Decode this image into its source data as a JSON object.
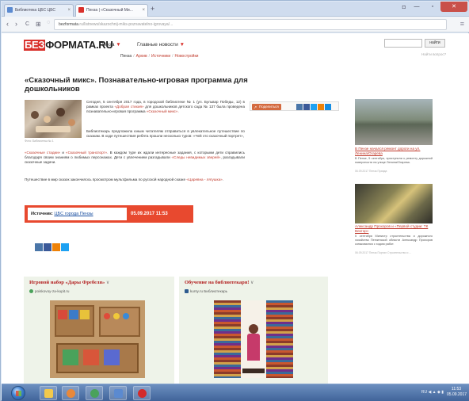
{
  "browser": {
    "tabs": [
      {
        "label": "Библиотека ЦБС ЦБС"
      },
      {
        "label": "Пенза | «Сказочный Ми..."
      }
    ],
    "new_tab": "+",
    "address_domain": "bezformata",
    "address_rest": ".ru/listnews/skazochnij-miks-poznavatelno-igrovaya/...",
    "nav_back": "‹",
    "nav_forward": "›",
    "nav_reload": "C",
    "nav_grid": "⊞",
    "menu": "≡"
  },
  "site": {
    "logo_be": "БЕЗ",
    "logo_rest": "ФОРМАТА.RU",
    "city": "Пенза",
    "main_news": "Главные новости",
    "arrow": "▼",
    "search_button": "найти",
    "advanced_search": "Найти вопрос?",
    "subnav": [
      "Пенза",
      "Архив",
      "Источники",
      "Новостройки"
    ]
  },
  "article": {
    "title": "«Сказочный микс». Познавательно-игровая программа для дошкольников",
    "photo_caption": "Фото: Библиотека № 1",
    "p1_text": "Сегодня, 5 сентября 2017 года, в городской библиотеке № 1 (ул. Бульвар Победы, 12) в рамках проекта ",
    "p1_link": "«Добрая стихия»",
    "p1_tail": " для дошкольников детского сада № 137 была проведена познавательно-игровая программа ",
    "p1_link2": "«Сказочный микс».",
    "p2_text": "Библиотекарь предложила юным читателям отправиться в увлекательное путешествие по сказкам. В ходе путешествия ребята прошли несколько туров: «Чей это сказочный портрет»,",
    "p3_link1": "«Сказочные стадии»",
    "p3_mid": " и ",
    "p3_link2": "«Сказочный транспорт»",
    "p3_text": ". В каждом туре их ждали интересные задания, с которыми дети справились благодаря своим знаниям о любимых персонажах. Дети с увлечением разгадывали ",
    "p3_link3": "«Следы невидимых зверей»",
    "p3_tail": ", разгадывали сказочные задачи.",
    "p4_text": "Путешествие в мир сказок закончилось просмотром мультфильма по русской народной сказке ",
    "p4_link": "«Царевна - лягушка»",
    "p4_tail": ".",
    "share_label": "Поделиться",
    "source_label": "Источник:",
    "source_name": "ЦБС города Пензы",
    "source_datetime": "05.09.2017  11:53"
  },
  "sidebar": {
    "item1_title": "В Пензе начался ремонт дороги на ул. Ленина/Огарева",
    "item1_text": "В Пензе, 5 сентября, приступили к ремонту дорожной поверхности на улице Ленина/Огарева.",
    "item1_meta": "06.09.2017  Пенза Правда",
    "item2_title": "Александр Прохоров и «Первой студии: ТК Вектор»",
    "item2_text": "5 сентября Министр строительства и дорожного хозяйства Пензенской области Александр Прохоров ознакомился с ходом работ.",
    "item2_meta": "06.09.2017  Пенза Портал  Строительство и ..."
  },
  "ads": [
    {
      "title": "Игровой набор «Дары Фребеля»",
      "chev": "∨",
      "domain": "poiskovoy-za-kupit.ru"
    },
    {
      "title": "Обучение на библиотекаря!",
      "chev": "∨",
      "domain": "kursy.ru Библиотекарь"
    }
  ],
  "taskbar": {
    "tray_text": "RU  ◀  ▲  ◆  ▮",
    "clock_time": "11:53",
    "clock_date": "05.09.2017"
  },
  "colors": {
    "brand_red": "#d9302b",
    "source_bar": "#e8492f",
    "link_red": "#c0392b"
  }
}
